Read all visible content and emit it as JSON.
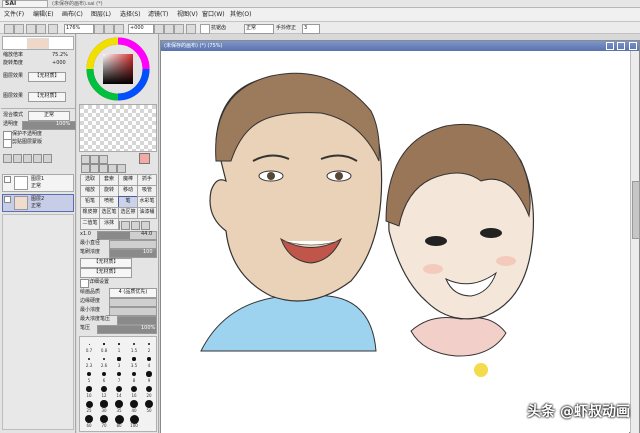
{
  "app": {
    "logo": "SAI",
    "window_title": "(未保存的画布).sai (*)"
  },
  "menu": [
    {
      "label": "文件(F)"
    },
    {
      "label": "编辑(E)"
    },
    {
      "label": "画布(C)"
    },
    {
      "label": "图层(L)"
    },
    {
      "label": "选择(S)"
    },
    {
      "label": "滤镜(T)"
    },
    {
      "label": "视图(V)"
    },
    {
      "label": "窗口(W)"
    },
    {
      "label": "其他(O)"
    }
  ],
  "toolbar": {
    "zoom": "176%",
    "angle": "+000",
    "antialias": "抗锯齿",
    "normal": "正常",
    "stabilizer": "手抖修正",
    "stabilizer_value": "3"
  },
  "navigator": {
    "zoom_label": "缩放倍率",
    "zoom_value": "75.2%",
    "angle_label": "旋转角度",
    "angle_value": "+000"
  },
  "colors": {
    "primary": "#f2aaa4",
    "secondary": "#ffffff",
    "accent": "#5a72ad"
  },
  "left": {
    "opacity_label": "透明度",
    "opacity_value": "100%",
    "protect_label": "保护不透明度",
    "clip_label": "剪贴图层蒙版",
    "mode_label": "混合模式",
    "mode_value": "正常",
    "layers": [
      {
        "name": "图层1",
        "mode": "正常",
        "opacity": "100%"
      },
      {
        "name": "图层2",
        "mode": "正常",
        "opacity": "100%"
      }
    ]
  },
  "tools": {
    "items": [
      "选取",
      "套索",
      "魔棒",
      "抓手",
      "缩放",
      "旋转",
      "移动",
      "吸管",
      "铅笔",
      "喷枪",
      "笔",
      "水彩笔",
      "橡皮擦",
      "选区笔",
      "选区擦",
      "油漆桶",
      "二值笔",
      "涂抹"
    ],
    "shape_label": "正常",
    "size_label": "最大直径",
    "size_value": "x1.0",
    "size_num": "44.0",
    "min_label": "最小直径",
    "min_value": "0%",
    "density_label": "笔刷浓度",
    "density_value": "100",
    "shape1": "【无材质】",
    "shape2": "【无材质】",
    "detail_label": "详细设置",
    "quality_label": "绘画品质",
    "quality_value": "4 (品质优先)",
    "edge_label": "边缘硬度",
    "min_density_label": "最小浓度",
    "max_density_label": "最大浓度笔压",
    "pressure_label": "笔压",
    "pressure_value": "100%",
    "sizes": [
      "0.7",
      "0.8",
      "1",
      "1.5",
      "2",
      "2.3",
      "2.6",
      "3",
      "3.5",
      "4",
      "5",
      "6",
      "7",
      "8",
      "9",
      "10",
      "12",
      "14",
      "16",
      "20",
      "25",
      "30",
      "35",
      "40",
      "50",
      "60",
      "70",
      "80",
      "100"
    ]
  },
  "canvas": {
    "title": "(未保存的画布) (*) (75%)"
  },
  "watermark": "头条 @虾叔动画"
}
